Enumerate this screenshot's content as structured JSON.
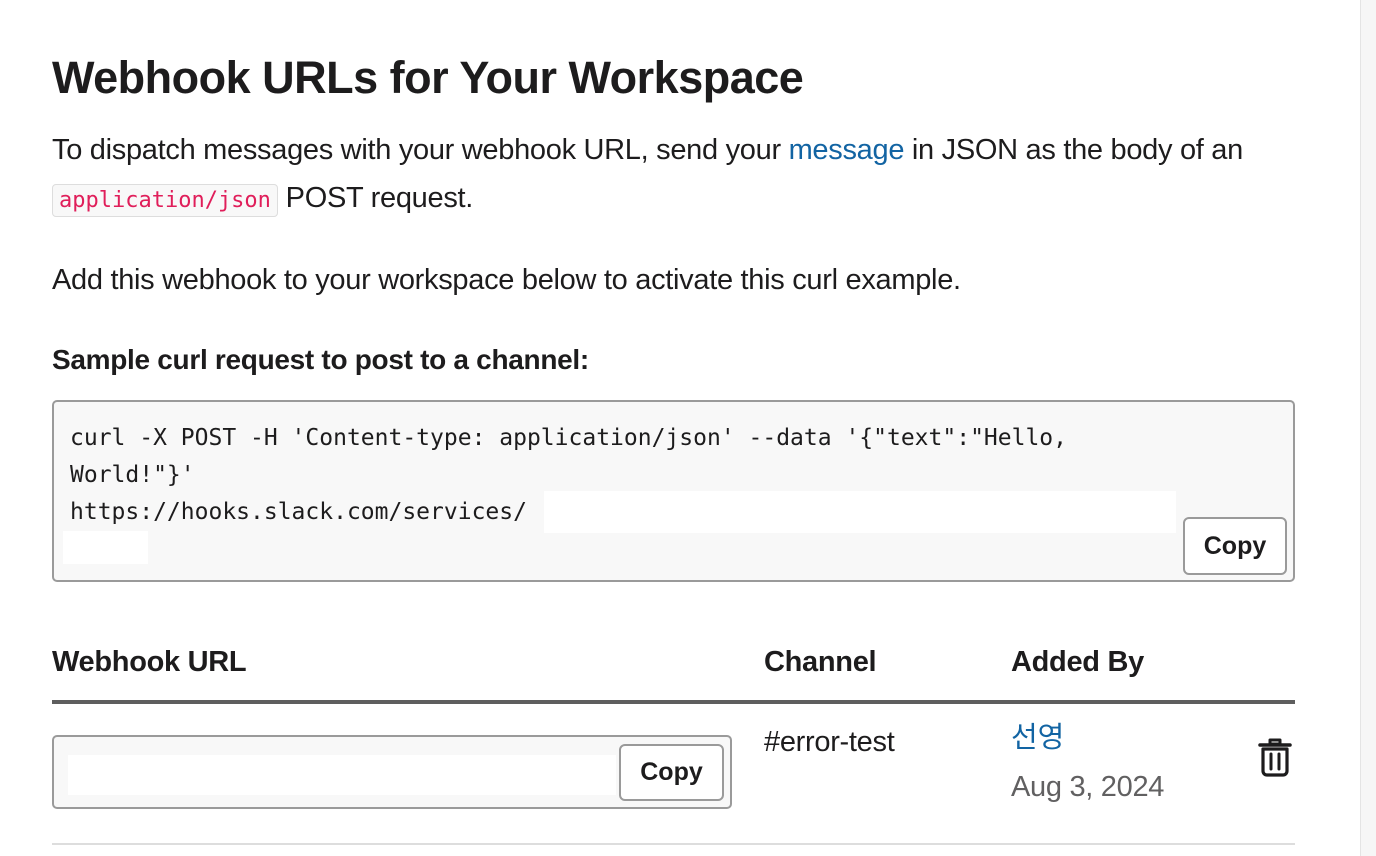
{
  "page": {
    "title": "Webhook URLs for Your Workspace",
    "intro_before_link": "To dispatch messages with your webhook URL, send your ",
    "intro_link": "message",
    "intro_after_link": " in JSON as the body of an ",
    "intro_code": "application/json",
    "intro_end": " POST request.",
    "activate_note": "Add this webhook to your workspace below to activate this curl example."
  },
  "sample": {
    "title": "Sample curl request to post to a channel:",
    "lines": [
      "curl -X POST -H 'Content-type: application/json' --data '{\"text\":\"Hello,",
      "World!\"}'",
      "https://hooks.slack.com/services/"
    ],
    "copy_label": "Copy"
  },
  "table": {
    "headers": {
      "webhook_url": "Webhook URL",
      "channel": "Channel",
      "added_by": "Added By"
    },
    "rows": [
      {
        "copy_label": "Copy",
        "channel": "#error-test",
        "added_by_user": "선영",
        "added_date": "Aug 3, 2024"
      }
    ]
  },
  "icons": {
    "delete": "trash-icon"
  },
  "colors": {
    "link": "#1264a3",
    "inline_code": "#e01e5a",
    "text": "#1d1c1d",
    "muted": "#616061"
  }
}
